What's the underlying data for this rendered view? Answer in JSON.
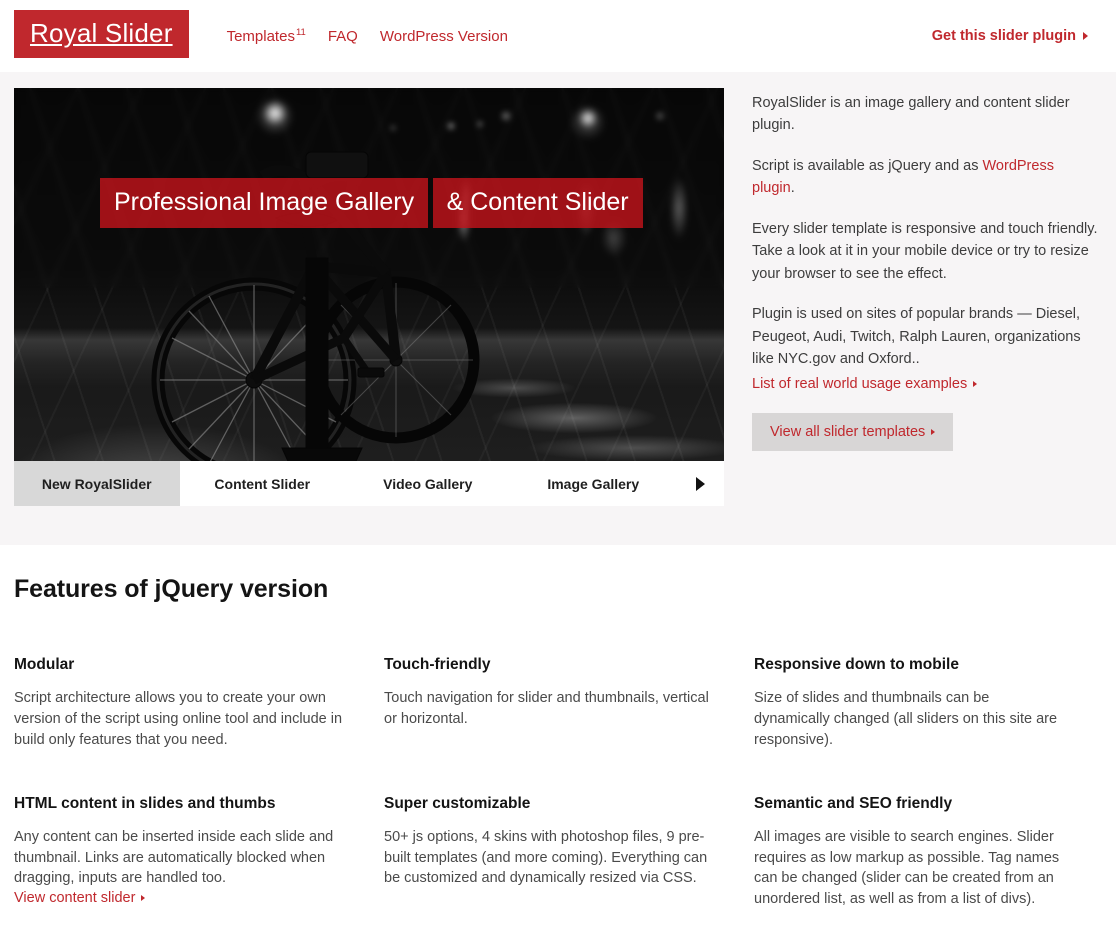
{
  "header": {
    "logo": "Royal Slider",
    "nav": [
      {
        "label": "Templates",
        "sup": "11"
      },
      {
        "label": "FAQ",
        "sup": ""
      },
      {
        "label": "WordPress Version",
        "sup": ""
      }
    ],
    "cta": "Get this slider plugin"
  },
  "hero": {
    "slide": {
      "caption_line1": "Professional Image Gallery",
      "caption_line2": "& Content Slider",
      "image_alt": "Black and white night photo of a bicycle parked on a wet city street"
    },
    "tabs": [
      {
        "label": "New RoyalSlider",
        "active": true
      },
      {
        "label": "Content Slider",
        "active": false
      },
      {
        "label": "Video Gallery",
        "active": false
      },
      {
        "label": "Image Gallery",
        "active": false
      }
    ],
    "info": {
      "p1": "RoyalSlider is an image gallery and content slider plugin.",
      "p2_before": "Script is available as jQuery and as ",
      "p2_link": "WordPress plugin",
      "p2_after": ".",
      "p3": "Every slider template is responsive and touch friendly. Take a look at it in your mobile device or try to resize your browser to see the effect.",
      "p4": "Plugin is used on sites of popular brands — Diesel, Peugeot, Audi, Twitch, Ralph Lauren, organizations like NYC.gov and Oxford..",
      "examples_link": "List of real world usage examples",
      "button": "View all slider templates"
    }
  },
  "features": {
    "heading": "Features of jQuery version",
    "items": [
      {
        "title": "Modular",
        "body": "Script architecture allows you to create your own version of the script using online tool and include in build only features that you need.",
        "link": ""
      },
      {
        "title": "Touch-friendly",
        "body": "Touch navigation for slider and thumbnails, vertical or horizontal.",
        "link": ""
      },
      {
        "title": "Responsive down to mobile",
        "body": "Size of slides and thumbnails can be dynamically changed (all sliders on this site are responsive).",
        "link": ""
      },
      {
        "title": "HTML content in slides and thumbs",
        "body": "Any content can be inserted inside each slide and thumbnail. Links are automatically blocked when dragging, inputs are handled too.",
        "link": "View content slider"
      },
      {
        "title": "Super customizable",
        "body": "50+ js options, 4 skins with photoshop files, 9 pre-built templates (and more coming). Everything can be customized and dynamically resized via CSS.",
        "link": ""
      },
      {
        "title": "Semantic and SEO friendly",
        "body": "All images are visible to search engines. Slider requires as low markup as possible. Tag names can be changed (slider can be created from an unordered list, as well as from a list of divs).",
        "link": ""
      }
    ]
  },
  "colors": {
    "brand_red": "#c0282d",
    "caption_red": "#c1141b",
    "hero_bg": "#f7f5f6",
    "tab_active_bg": "#d8d8d8",
    "button_bg": "#d8d6d6",
    "text_dark": "#141414",
    "text_body": "#4a4a4a"
  }
}
